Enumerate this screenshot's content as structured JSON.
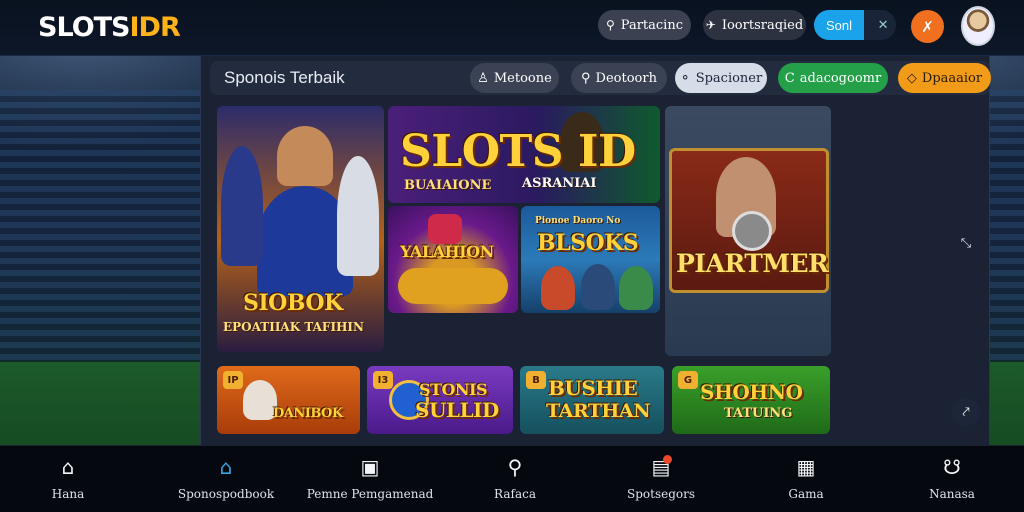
{
  "app": {
    "logo_a": "SLOTS",
    "logo_b": "IDR"
  },
  "topbar": {
    "search_label": "Partacinc",
    "tournament_label": "Ioortsraqied",
    "send_label": "Sonl",
    "close_glyph": "✕",
    "notify_glyph": "✗"
  },
  "subbar": {
    "title": "Sponois Terbaik",
    "filters": [
      {
        "label": "Metoone",
        "icon": "♙"
      },
      {
        "label": "Deotoorh",
        "icon": "⚲"
      },
      {
        "label": "Spacioner",
        "icon": "⚬"
      },
      {
        "label": "adacogoomr",
        "icon": "C"
      },
      {
        "label": "Dpaaaior",
        "icon": "◇"
      }
    ]
  },
  "games": {
    "c1": {
      "title": "SIOBOK",
      "sub": "EPOATIIAK TAFIHIN"
    },
    "c2": {
      "title": "SLOTS ID",
      "sub": "BUAIAIONE",
      "sub2": "ASRANIAI"
    },
    "c3": {
      "title": "YALAHION"
    },
    "c4": {
      "title": "BLSOKS",
      "sub": "Pionoe Daoro No"
    },
    "c5": {
      "title": "PIARTMER"
    },
    "c6": {
      "badge": "IP",
      "title": "DANIBOK"
    },
    "c7": {
      "badge": "I3",
      "title": "STONIS",
      "sub": "SULLID"
    },
    "c8": {
      "badge": "B",
      "title": "BUSHIE",
      "sub": "TARTHAN"
    },
    "c9": {
      "badge": "G",
      "title": "SHOHNO",
      "sub": "TATUING"
    }
  },
  "side": {
    "arrow_glyph": "⤡",
    "chat_glyph": "⤤"
  },
  "bottomnav": {
    "items": [
      {
        "label": "Hana",
        "icon": "⌂"
      },
      {
        "label": "Sponospodbook",
        "icon": "⌂"
      },
      {
        "label": "Pemne Pemgamenad",
        "icon": "▣"
      },
      {
        "label": "Rafaca",
        "icon": "⚲"
      },
      {
        "label": "Spotsegors",
        "icon": "▤"
      },
      {
        "label": "Gama",
        "icon": "▦"
      },
      {
        "label": "Nanasa",
        "icon": "☋"
      }
    ]
  },
  "colors": {
    "accent_blue": "#1aa2ea",
    "accent_orange": "#f07020",
    "logo_gold": "#ffb21a",
    "filter_green": "#24a049",
    "filter_orange": "#f29b18"
  }
}
